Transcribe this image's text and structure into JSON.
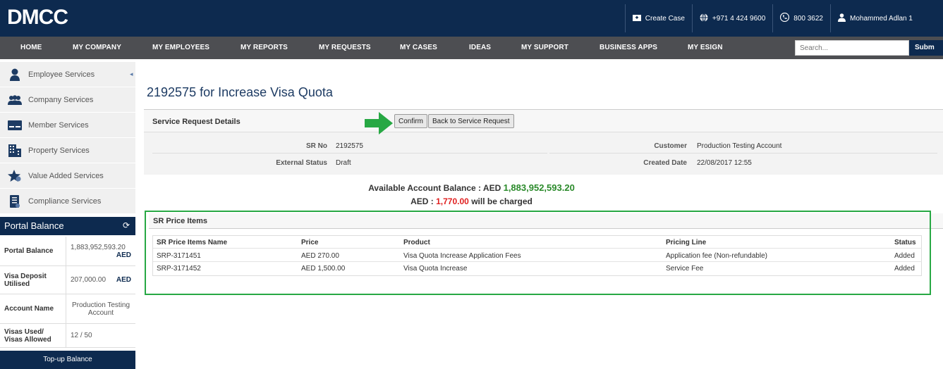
{
  "header": {
    "logo": "DMCC",
    "actions": [
      {
        "label": "Create Case",
        "icon": "folder-plus-icon"
      },
      {
        "label": "+971 4 424 9600",
        "icon": "globe-icon"
      },
      {
        "label": "800 3622",
        "icon": "phone-icon"
      },
      {
        "label": "Mohammed Adlan 1",
        "icon": "user-icon"
      }
    ]
  },
  "nav": {
    "items": [
      "HOME",
      "MY COMPANY",
      "MY EMPLOYEES",
      "MY REPORTS",
      "MY REQUESTS",
      "MY CASES",
      "IDEAS",
      "MY SUPPORT",
      "BUSINESS APPS",
      "MY ESIGN"
    ],
    "search_placeholder": "Search...",
    "submit_label": "Subm"
  },
  "sidebar": {
    "items": [
      {
        "label": "Employee Services",
        "icon": "employee-icon"
      },
      {
        "label": "Company Services",
        "icon": "group-icon"
      },
      {
        "label": "Member Services",
        "icon": "member-card-icon"
      },
      {
        "label": "Property Services",
        "icon": "building-icon"
      },
      {
        "label": "Value Added Services",
        "icon": "star-icon"
      },
      {
        "label": "Compliance Services",
        "icon": "document-icon"
      }
    ],
    "portal_balance": {
      "title": "Portal Balance",
      "rows": [
        {
          "label": "Portal Balance",
          "value": "1,883,952,593.20",
          "unit": "AED"
        },
        {
          "label": "Visa Deposit Utilised",
          "value": "207,000.00",
          "unit": "AED"
        },
        {
          "label": "Account Name",
          "value": "Production Testing Account",
          "unit": ""
        },
        {
          "label": "Visas Used/ Visas Allowed",
          "value": "12 / 50",
          "unit": ""
        }
      ],
      "topup_label": "Top-up Balance"
    }
  },
  "main": {
    "title": "2192575 for Increase Visa Quota",
    "details": {
      "heading": "Service Request Details",
      "confirm_label": "Confirm",
      "back_label": "Back to Service Request",
      "sr_no_label": "SR No",
      "sr_no": "2192575",
      "external_status_label": "External Status",
      "external_status": "Draft",
      "customer_label": "Customer",
      "customer": "Production Testing Account",
      "created_date_label": "Created Date",
      "created_date": "22/08/2017 12:55"
    },
    "balance": {
      "available_label": "Available Account Balance : AED",
      "available_value": "1,883,952,593.20",
      "charge_prefix": "AED :",
      "charge_value": "1,770.00",
      "charge_suffix": "will be charged"
    },
    "price_items": {
      "heading": "SR Price Items",
      "columns": [
        "SR Price Items Name",
        "Price",
        "Product",
        "Pricing Line",
        "Status"
      ],
      "rows": [
        [
          "SRP-3171451",
          "AED 270.00",
          "Visa Quota Increase Application Fees",
          "Application fee (Non-refundable)",
          "Added"
        ],
        [
          "SRP-3171452",
          "AED 1,500.00",
          "Visa Quota Increase",
          "Service Fee",
          "Added"
        ]
      ]
    }
  }
}
